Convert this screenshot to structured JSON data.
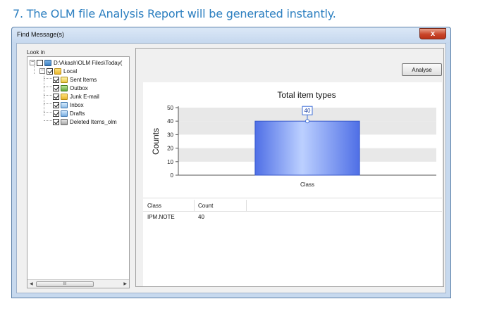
{
  "caption": "7. The OLM file Analysis Report will be generated instantly.",
  "window": {
    "title": "Find Message(s)",
    "close_label": "x"
  },
  "tree": {
    "label": "Look in",
    "root": "D:\\Akash\\OLM Files\\Today(",
    "local": "Local",
    "items": [
      "Sent Items",
      "Outbox",
      "Junk E-mail",
      "Inbox",
      "Drafts",
      "Deleted Items_olm"
    ],
    "scroll_grip": "III"
  },
  "buttons": {
    "analyse": "Analyse"
  },
  "chart_data": {
    "type": "bar",
    "title": "Total item types",
    "ylabel": "Counts",
    "xlabel": "",
    "categories": [
      "Class"
    ],
    "values": [
      40
    ],
    "data_labels": [
      "40"
    ],
    "ylim": [
      0,
      50
    ],
    "yticks": [
      0,
      10,
      20,
      30,
      40,
      50
    ],
    "grid": true,
    "bar_color": "#4f6fe6",
    "band_color": "#e8e8e8"
  },
  "table": {
    "headers": [
      "Class",
      "Count"
    ],
    "rows": [
      [
        "IPM.NOTE",
        "40"
      ]
    ]
  }
}
